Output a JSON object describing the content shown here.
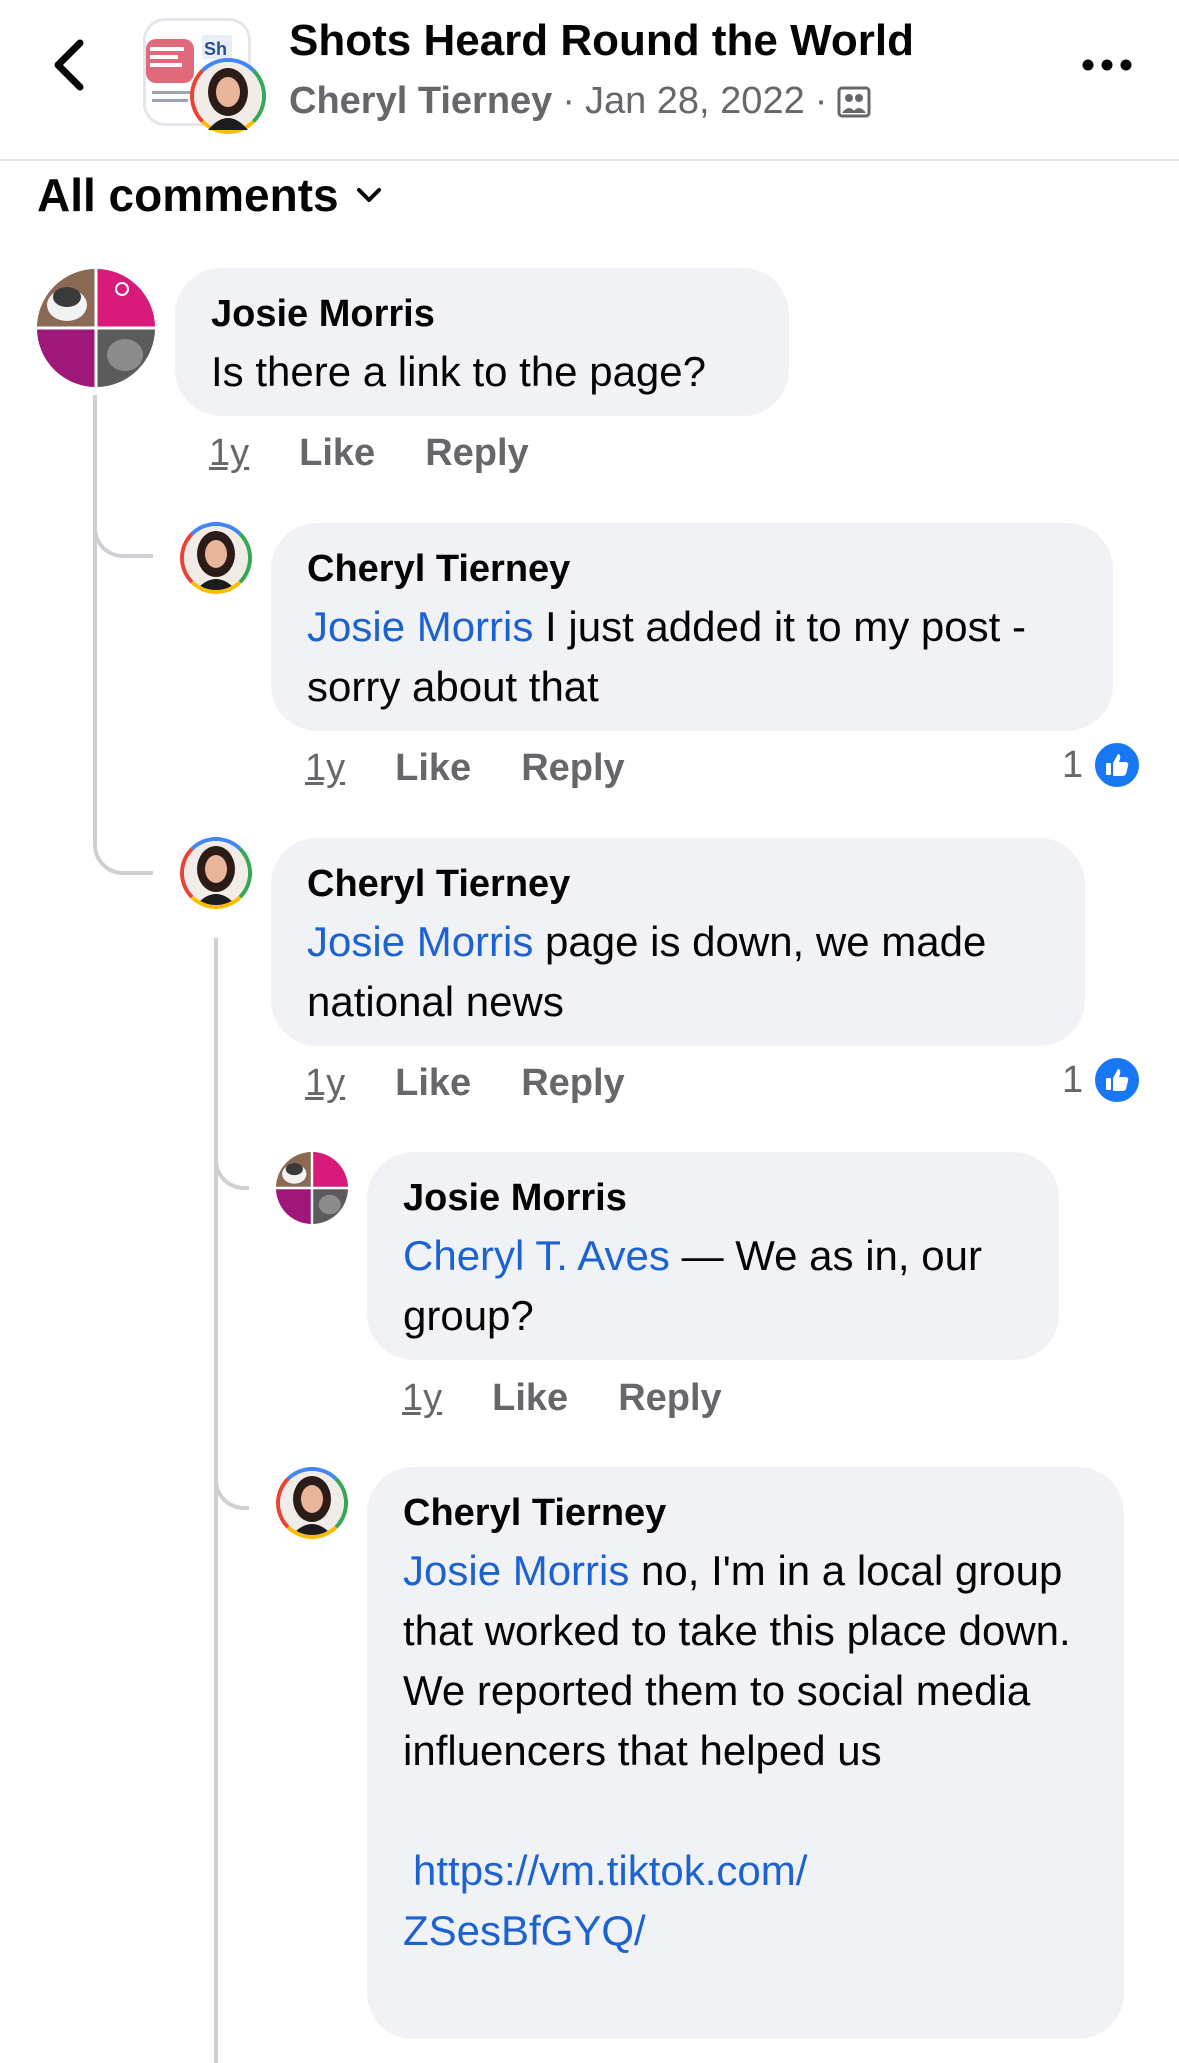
{
  "header": {
    "title": "Shots Heard Round the World",
    "author": "Cheryl Tierney",
    "date": "Jan 28, 2022",
    "separator": "·"
  },
  "filter": {
    "label": "All comments"
  },
  "comments": [
    {
      "name": "Josie Morris",
      "mention": "",
      "text": "Is there a link to the page?",
      "time": "1y",
      "like": "Like",
      "reply": "Reply",
      "reactions": ""
    },
    {
      "name": "Cheryl Tierney",
      "mention": "Josie Morris",
      "text": "I just added it to my post - sorry about that",
      "time": "1y",
      "like": "Like",
      "reply": "Reply",
      "reactions": "1"
    },
    {
      "name": "Cheryl Tierney",
      "mention": "Josie Morris",
      "text": "page is down, we made national news",
      "time": "1y",
      "like": "Like",
      "reply": "Reply",
      "reactions": "1"
    },
    {
      "name": "Josie Morris",
      "mention": "Cheryl T. Aves",
      "text": "— We as in, our group?",
      "time": "1y",
      "like": "Like",
      "reply": "Reply",
      "reactions": ""
    },
    {
      "name": "Cheryl Tierney",
      "mention": "Josie Morris",
      "text": "no, I'm in a local group that worked to take this place down. We reported them to social media influencers that helped us",
      "link": "https://vm.tiktok.com/ZSesBfGYQ/",
      "link_line1": "https://vm.tiktok.com/",
      "link_line2": "ZSesBfGYQ/"
    }
  ],
  "colors": {
    "mention": "#1d62d1",
    "bubble": "#f0f2f5",
    "like_badge": "#1877f2",
    "secondary_text": "#65676b"
  },
  "icons": {
    "back": "chevron-left-icon",
    "more": "more-horizontal-icon",
    "audience": "group-audience-icon",
    "filter": "chevron-down-icon",
    "like_badge": "thumbs-up-icon"
  }
}
